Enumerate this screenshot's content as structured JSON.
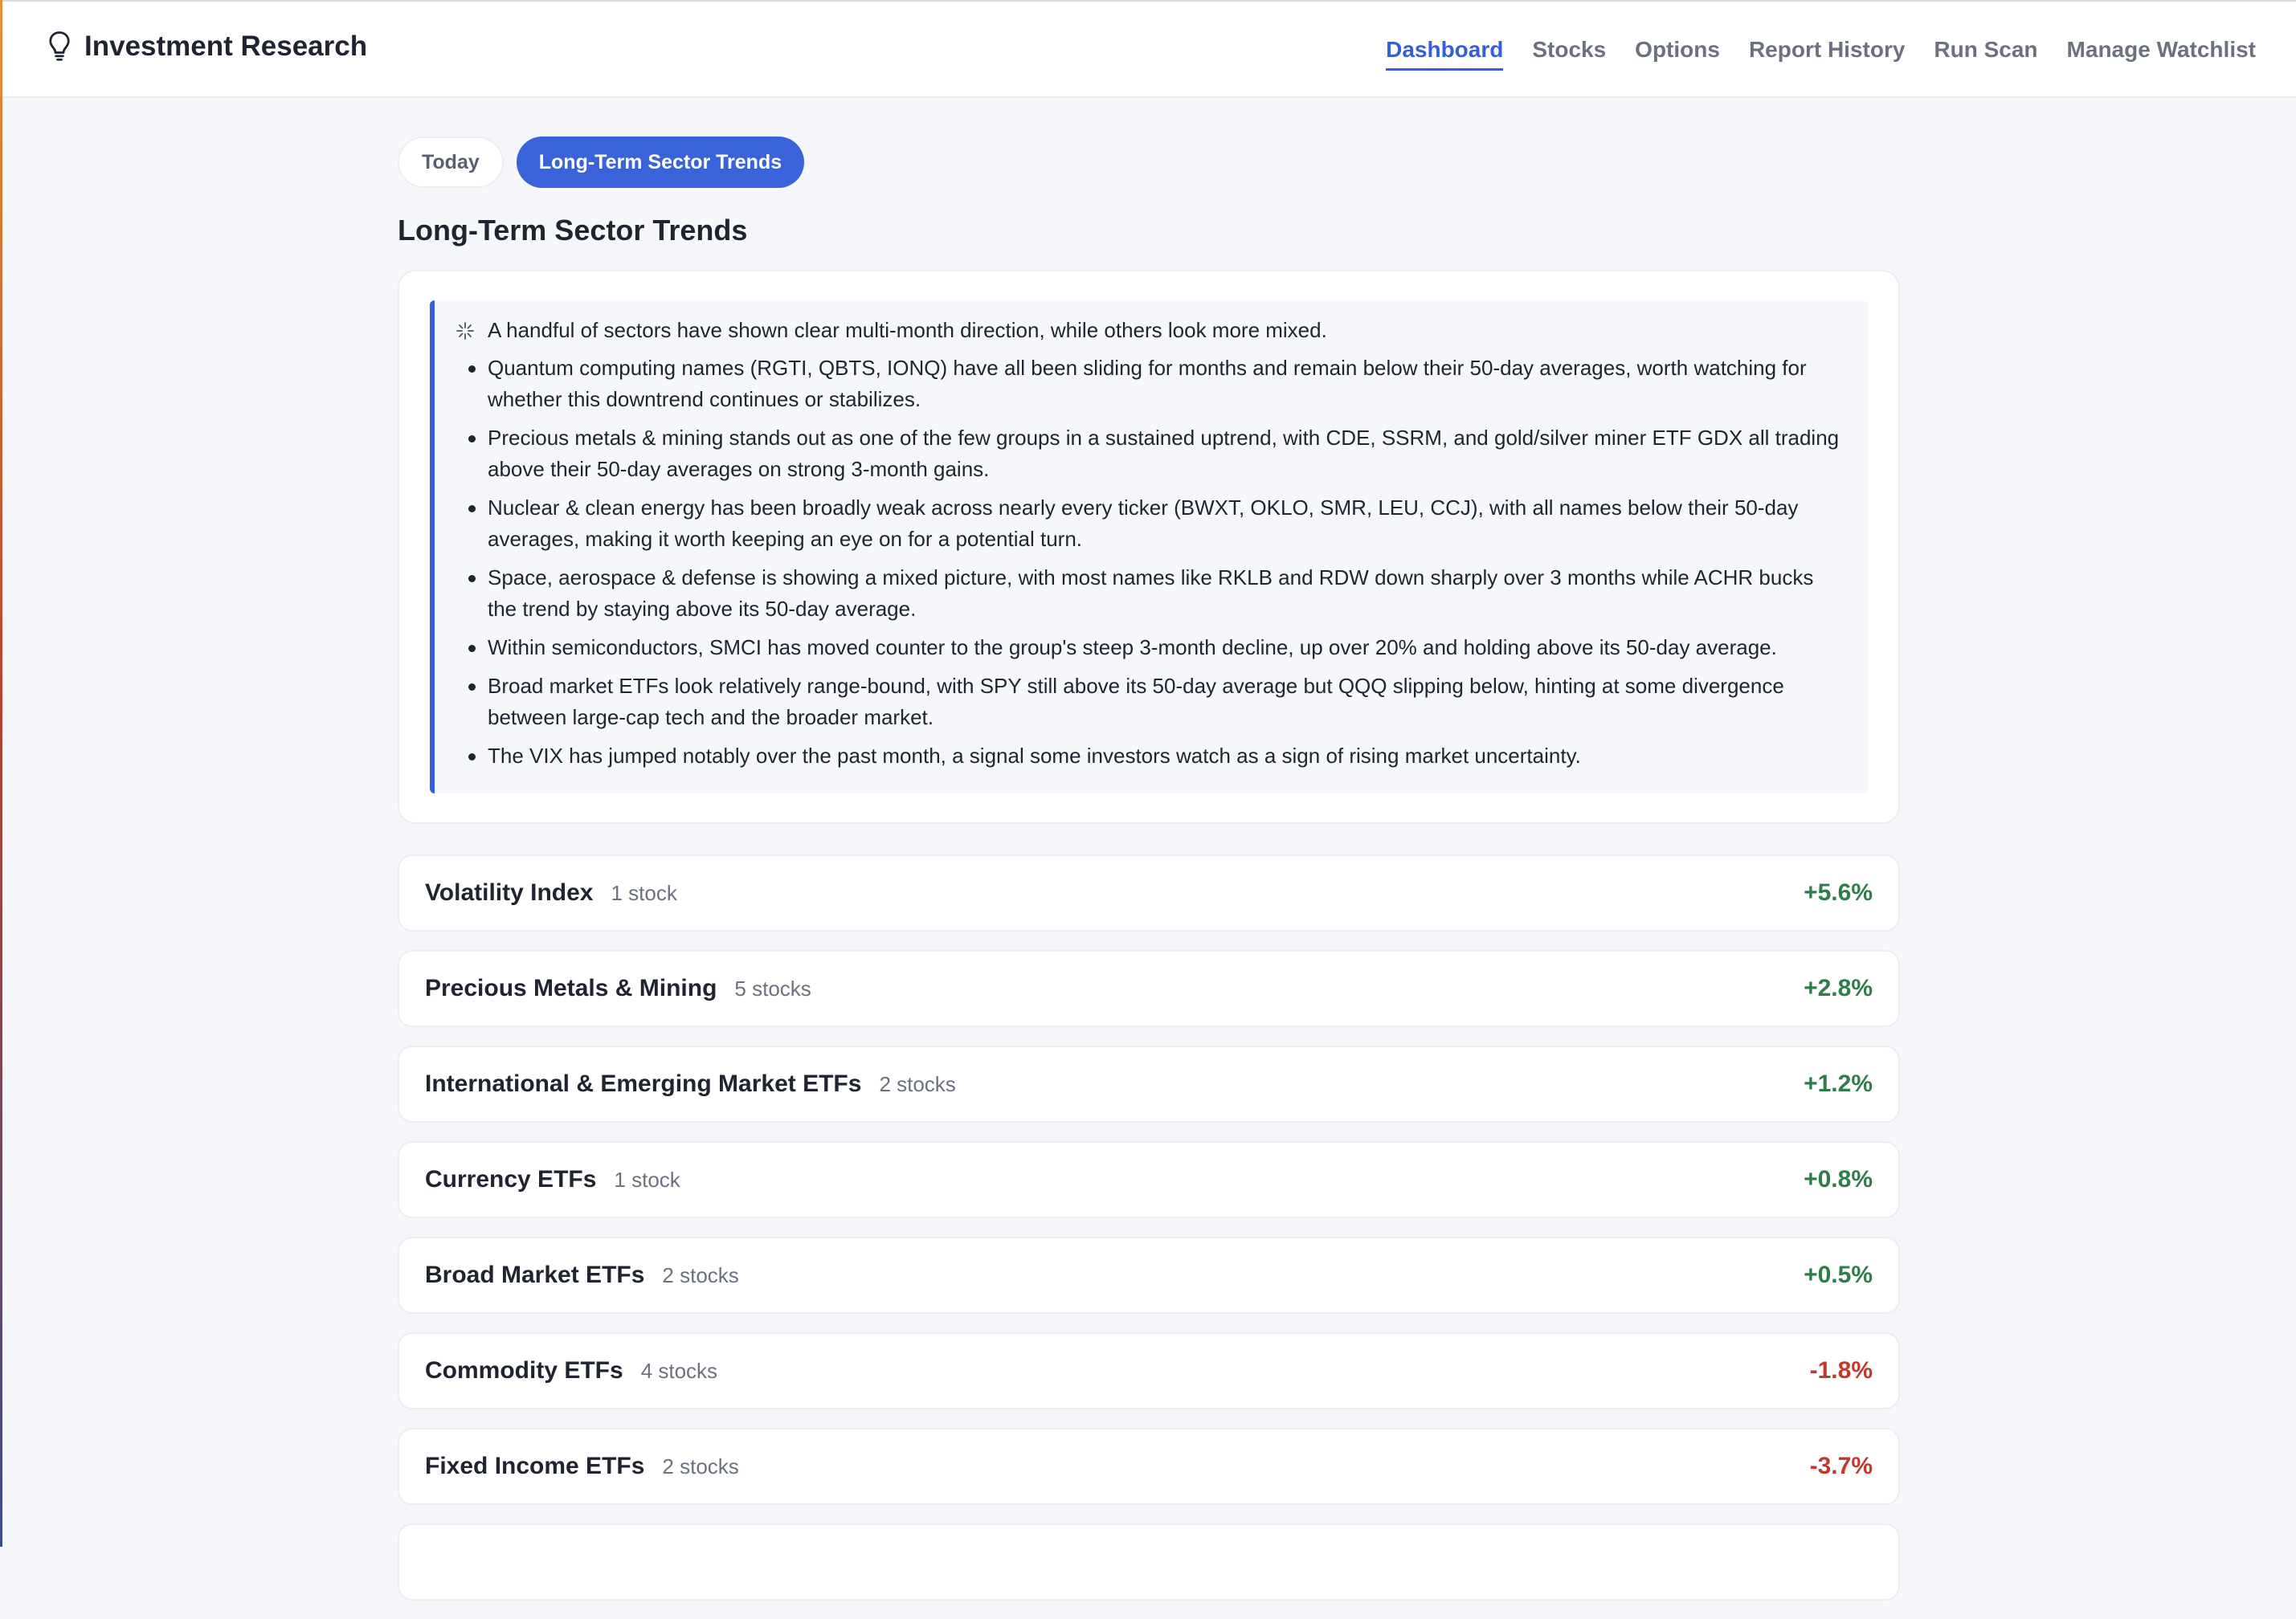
{
  "app": {
    "title": "Investment Research",
    "icon": "lightbulb-icon"
  },
  "nav": {
    "items": [
      {
        "label": "Dashboard",
        "active": true
      },
      {
        "label": "Stocks",
        "active": false
      },
      {
        "label": "Options",
        "active": false
      },
      {
        "label": "Report History",
        "active": false
      },
      {
        "label": "Run Scan",
        "active": false
      },
      {
        "label": "Manage Watchlist",
        "active": false
      }
    ]
  },
  "tabs": {
    "today": "Today",
    "trends": "Long-Term Sector Trends",
    "active": "trends"
  },
  "page_title": "Long-Term Sector Trends",
  "summary": {
    "icon": "sparkle-icon",
    "intro": "A handful of sectors have shown clear multi-month direction, while others look more mixed.",
    "bullets": [
      "Quantum computing names (RGTI, QBTS, IONQ) have all been sliding for months and remain below their 50-day averages, worth watching for whether this downtrend continues or stabilizes.",
      "Precious metals & mining stands out as one of the few groups in a sustained uptrend, with CDE, SSRM, and gold/silver miner ETF GDX all trading above their 50-day averages on strong 3-month gains.",
      "Nuclear & clean energy has been broadly weak across nearly every ticker (BWXT, OKLO, SMR, LEU, CCJ), with all names below their 50-day averages, making it worth keeping an eye on for a potential turn.",
      "Space, aerospace & defense is showing a mixed picture, with most names like RKLB and RDW down sharply over 3 months while ACHR bucks the trend by staying above its 50-day average.",
      "Within semiconductors, SMCI has moved counter to the group's steep 3-month decline, up over 20% and holding above its 50-day average.",
      "Broad market ETFs look relatively range-bound, with SPY still above its 50-day average but QQQ slipping below, hinting at some divergence between large-cap tech and the broader market.",
      "The VIX has jumped notably over the past month, a signal some investors watch as a sign of rising market uncertainty."
    ]
  },
  "sectors": [
    {
      "name": "Volatility Index",
      "count": "1 stock",
      "change": "+5.6%",
      "direction": "up"
    },
    {
      "name": "Precious Metals & Mining",
      "count": "5 stocks",
      "change": "+2.8%",
      "direction": "up"
    },
    {
      "name": "International & Emerging Market ETFs",
      "count": "2 stocks",
      "change": "+1.2%",
      "direction": "up"
    },
    {
      "name": "Currency ETFs",
      "count": "1 stock",
      "change": "+0.8%",
      "direction": "up"
    },
    {
      "name": "Broad Market ETFs",
      "count": "2 stocks",
      "change": "+0.5%",
      "direction": "up"
    },
    {
      "name": "Commodity ETFs",
      "count": "4 stocks",
      "change": "-1.8%",
      "direction": "down"
    },
    {
      "name": "Fixed Income ETFs",
      "count": "2 stocks",
      "change": "-3.7%",
      "direction": "down"
    }
  ],
  "colors": {
    "accent": "#3560d8",
    "positive": "#2e7d4a",
    "negative": "#c0392b"
  }
}
